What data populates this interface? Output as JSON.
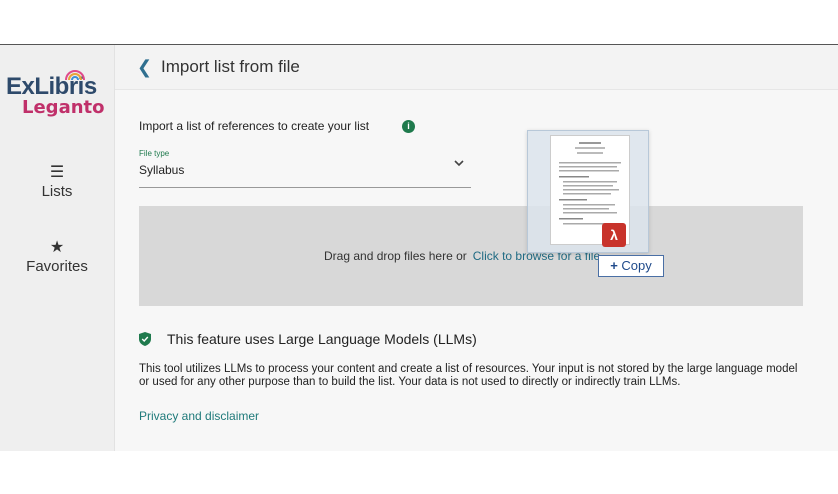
{
  "sidebar": {
    "logo": {
      "top": "ExLibris",
      "bottom": "Leganto"
    },
    "items": [
      {
        "label": "Lists",
        "icon": "list-icon"
      },
      {
        "label": "Favorites",
        "icon": "star-icon"
      }
    ]
  },
  "header": {
    "back_icon": "chevron-left-icon",
    "title": "Import list from file"
  },
  "form": {
    "intro": "Import a list of references to create your list",
    "file_type_label": "File type",
    "file_type_value": "Syllabus"
  },
  "dropzone": {
    "text": "Drag and drop files here or",
    "link": "Click to browse for a file"
  },
  "drag_tooltip": {
    "icon": "plus-icon",
    "label": "Copy"
  },
  "llm": {
    "title": "This feature uses Large Language Models (LLMs)",
    "description": "This tool utilizes LLMs to process your content and create a list of resources. Your input is not stored by the large language model or used for any other purpose than to build the list. Your data is not used to directly or indirectly train LLMs.",
    "privacy_link": "Privacy and disclaimer"
  },
  "colors": {
    "accent": "#1f7a4d",
    "link": "#1f6a83",
    "brand_pink": "#c0306a",
    "brand_blue": "#2e4a6b",
    "pdf_red": "#c8332b"
  }
}
